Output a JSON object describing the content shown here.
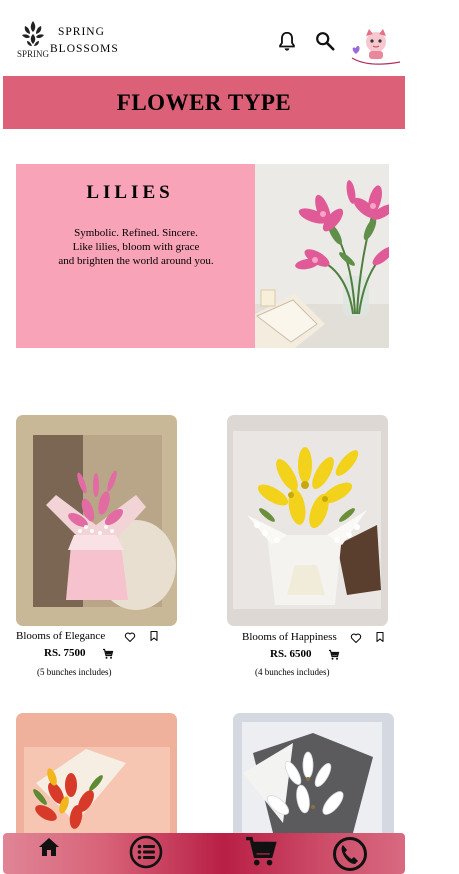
{
  "header": {
    "brand_line1": "SPRING",
    "brand_line2": "BLOSSOMS",
    "logo_word": "SPRING",
    "icons": [
      "bell-icon",
      "search-icon",
      "avatar"
    ]
  },
  "page_title": "FLOWER TYPE",
  "banner": {
    "heading": "LILIES",
    "line1": "Symbolic. Refined. Sincere.",
    "line2": "Like lilies, bloom with grace",
    "line3": "and brighten the world around you."
  },
  "products": [
    {
      "name": "Blooms of Elegance",
      "price": "RS. 7500",
      "note": "(5 bunches includes)"
    },
    {
      "name": "Blooms of Happiness",
      "price": "RS. 6500",
      "note": "(4 bunches includes)"
    }
  ],
  "bottom_nav": [
    "home-icon",
    "list-icon",
    "cart-icon",
    "phone-icon"
  ],
  "colors": {
    "title_bar": "#dc6077",
    "banner_bg": "#f9a3b8",
    "nav_dark": "#b81f45",
    "card1_bg": "#c8b898",
    "card2_bg": "#ddd8d3",
    "card3_bg": "#efb19c",
    "card4_bg": "#d4d8e0"
  }
}
